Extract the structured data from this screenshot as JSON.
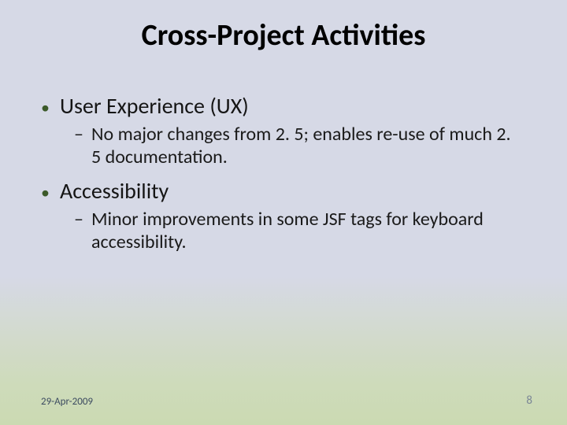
{
  "title": "Cross-Project Activities",
  "bullets": [
    {
      "text": "User Experience (UX)",
      "sub": "No major changes from 2. 5; enables re-use of much 2. 5 documentation."
    },
    {
      "text": "Accessibility",
      "sub": "Minor improvements in some JSF tags for keyboard accessibility."
    }
  ],
  "footer": {
    "date": "29-Apr-2009",
    "page": "8"
  },
  "marks": {
    "dot": "•",
    "dash": "–"
  }
}
